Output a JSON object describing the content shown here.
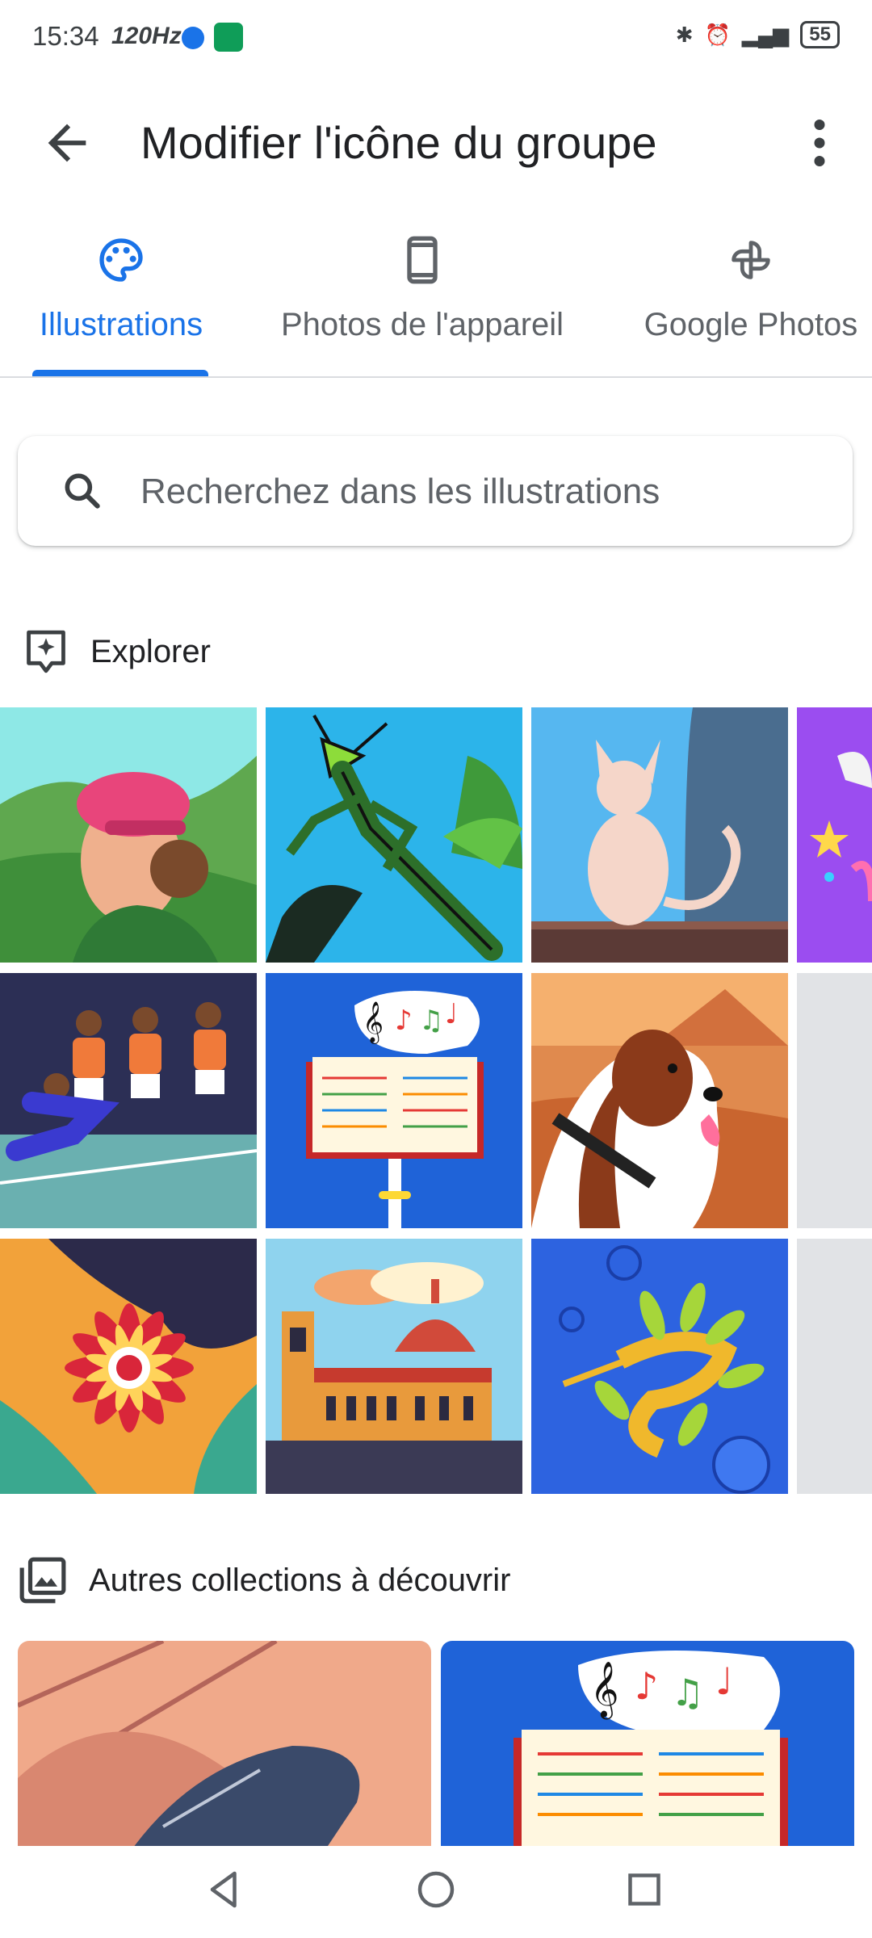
{
  "status_bar": {
    "time": "15:34",
    "refresh_rate": "120Hz",
    "battery": "55"
  },
  "app_bar": {
    "title": "Modifier l'icône du groupe"
  },
  "tabs": [
    {
      "label": "Illustrations",
      "icon": "palette-icon",
      "active": true
    },
    {
      "label": "Photos de l'appareil",
      "icon": "phone-icon",
      "active": false
    },
    {
      "label": "Google Photos",
      "icon": "pinwheel-icon",
      "active": false
    }
  ],
  "search": {
    "placeholder": "Recherchez dans les illustrations"
  },
  "explore": {
    "title": "Explorer"
  },
  "tiles": [
    "woman-pink-hat",
    "praying-mantis",
    "sphynx-cat",
    "purple-partial",
    "kabaddi-players",
    "music-book",
    "saint-bernard-dog",
    "gray-partial",
    "flower",
    "florence-cathedral",
    "leafy-seadragon",
    "gray-partial-2"
  ],
  "collections": {
    "title": "Autres collections à découvrir"
  },
  "colors": {
    "accent": "#1a73e8",
    "text": "#202124",
    "secondary": "#5f6368"
  }
}
